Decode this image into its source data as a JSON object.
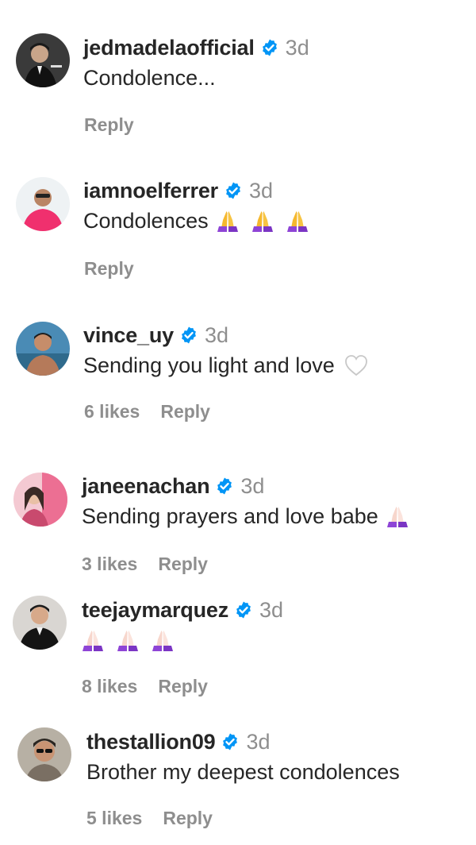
{
  "comments": [
    {
      "username": "jedmadelaofficial",
      "time": "3d",
      "text": "Condolence...",
      "likes": "",
      "reply": "Reply",
      "avatar": "avatar-man-in-suit"
    },
    {
      "username": "iamnoelferrer",
      "time": "3d",
      "text": "Condolences",
      "likes": "",
      "reply": "Reply",
      "emojis": [
        "folded-hands-purple",
        "folded-hands-purple",
        "folded-hands-purple"
      ],
      "avatar": "avatar-man-pink-shirt"
    },
    {
      "username": "vince_uy",
      "time": "3d",
      "text": "Sending you light and love",
      "likes": "6 likes",
      "reply": "Reply",
      "emojis": [
        "white-heart"
      ],
      "avatar": "avatar-man-outdoors"
    },
    {
      "username": "janeenachan",
      "time": "3d",
      "text": "Sending prayers and love babe",
      "likes": "3 likes",
      "reply": "Reply",
      "emojis": [
        "folded-hands-light"
      ],
      "avatar": "avatar-woman-pink"
    },
    {
      "username": "teejaymarquez",
      "time": "3d",
      "text": "",
      "likes": "8 likes",
      "reply": "Reply",
      "emojis": [
        "folded-hands-light",
        "folded-hands-light",
        "folded-hands-light"
      ],
      "avatar": "avatar-man-tuxedo"
    },
    {
      "username": "thestallion09",
      "time": "3d",
      "text": "Brother my deepest condolences",
      "likes": "5 likes",
      "reply": "Reply",
      "avatar": "avatar-man-sunglasses"
    }
  ],
  "colors": {
    "verified": "#0095f6",
    "secondary_text": "#8e8e8e",
    "primary_text": "#262626",
    "emoji_hands_purple_sleeve": "#8e44d6",
    "emoji_hands_yellow": "#f5b82e",
    "emoji_hands_light": "#f7d6cc"
  }
}
